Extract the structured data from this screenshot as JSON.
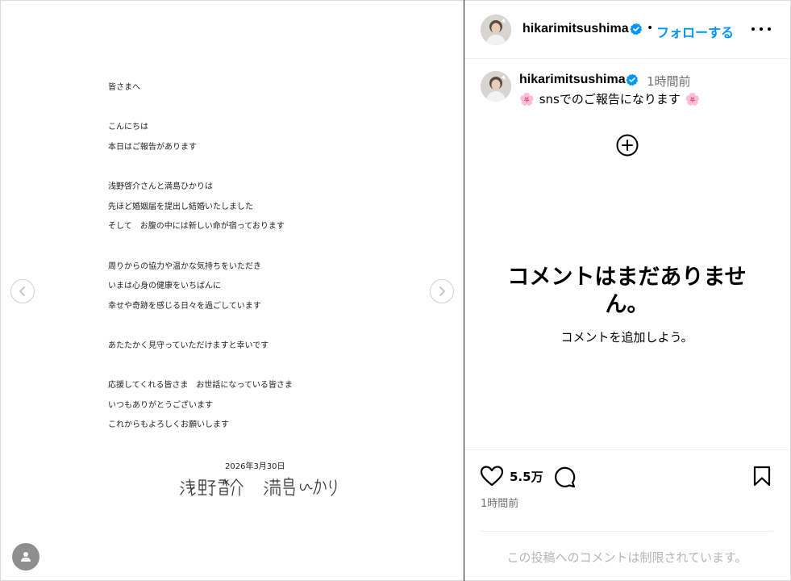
{
  "post": {
    "letter_lines": [
      "皆さまへ",
      "こんにちは",
      "本日はご報告があります",
      "浅野啓介さんと満島ひかりは",
      "先ほど婚姻届を提出し結婚いたしました",
      "そして　お腹の中には新しい命が宿っております",
      "周りからの協力や温かな気持ちをいただき",
      "いまは心身の健康をいちばんに",
      "幸せや奇跡を感じる日々を過ごしています",
      "あたたかく見守っていただけますと幸いです",
      "応援してくれる皆さま　お世話になっている皆さま",
      "いつもありがとうございます",
      "これからもよろしくお願いします"
    ],
    "letter_date": "2026年3月30日",
    "signature": "浅野啓介　満島ひかり"
  },
  "header": {
    "username": "hikarimitsushima",
    "separator": "•",
    "follow_label": "フォローする"
  },
  "caption": {
    "username": "hikarimitsushima",
    "time": "1時間前",
    "emoji": "🌸",
    "text": "snsでのご報告になります"
  },
  "comments": {
    "empty_title": "コメントはまだありません。",
    "empty_subtitle": "コメントを追加しよう。"
  },
  "actions": {
    "like_count": "5.5万",
    "post_time": "1時間前"
  },
  "footer": {
    "restricted_text": "この投稿へのコメントは制限されています。"
  },
  "icons": {
    "prev": "chevron-left-icon",
    "next": "chevron-right-icon",
    "tag": "user-tag-icon",
    "verified": "verified-badge-icon",
    "more": "more-options-icon",
    "add": "add-circle-icon",
    "like": "heart-icon",
    "comment": "comment-icon",
    "save": "bookmark-icon"
  },
  "colors": {
    "accent": "#0095f6",
    "verified": "#0095f6",
    "muted": "#737373",
    "restricted": "#b5b5b5"
  }
}
